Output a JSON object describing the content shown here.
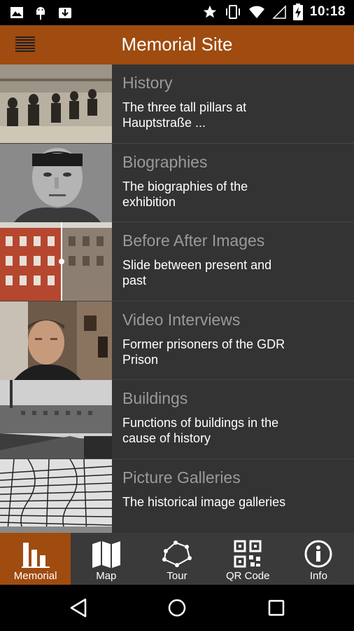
{
  "status_bar": {
    "time": "10:18",
    "icons": [
      "image-icon",
      "android-icon",
      "download-icon",
      "star-icon",
      "vibrate-icon",
      "wifi-icon",
      "signal-icon",
      "battery-charging-icon"
    ]
  },
  "app_bar": {
    "title": "Memorial Site",
    "menu_icon": "menu-icon"
  },
  "list": [
    {
      "title": "History",
      "subtitle": "The three tall pillars at Hauptstraße ..."
    },
    {
      "title": "Biographies",
      "subtitle": "The biographies of the exhibition"
    },
    {
      "title": "Before After Images",
      "subtitle": "Slide between present and past"
    },
    {
      "title": "Video Interviews",
      "subtitle": "Former prisoners of the GDR Prison"
    },
    {
      "title": "Buildings",
      "subtitle": "Functions of buildings in the cause of history"
    },
    {
      "title": "Picture Galleries",
      "subtitle": "The historical image galleries"
    }
  ],
  "bottom_nav": [
    {
      "label": "Memorial",
      "icon": "bar-chart-icon",
      "active": true
    },
    {
      "label": "Map",
      "icon": "map-icon",
      "active": false
    },
    {
      "label": "Tour",
      "icon": "tour-icon",
      "active": false
    },
    {
      "label": "QR Code",
      "icon": "qr-code-icon",
      "active": false
    },
    {
      "label": "Info",
      "icon": "info-icon",
      "active": false
    }
  ],
  "colors": {
    "accent": "#a04b0f",
    "list_bg": "#333333",
    "title_grey": "#9a9a9a"
  }
}
